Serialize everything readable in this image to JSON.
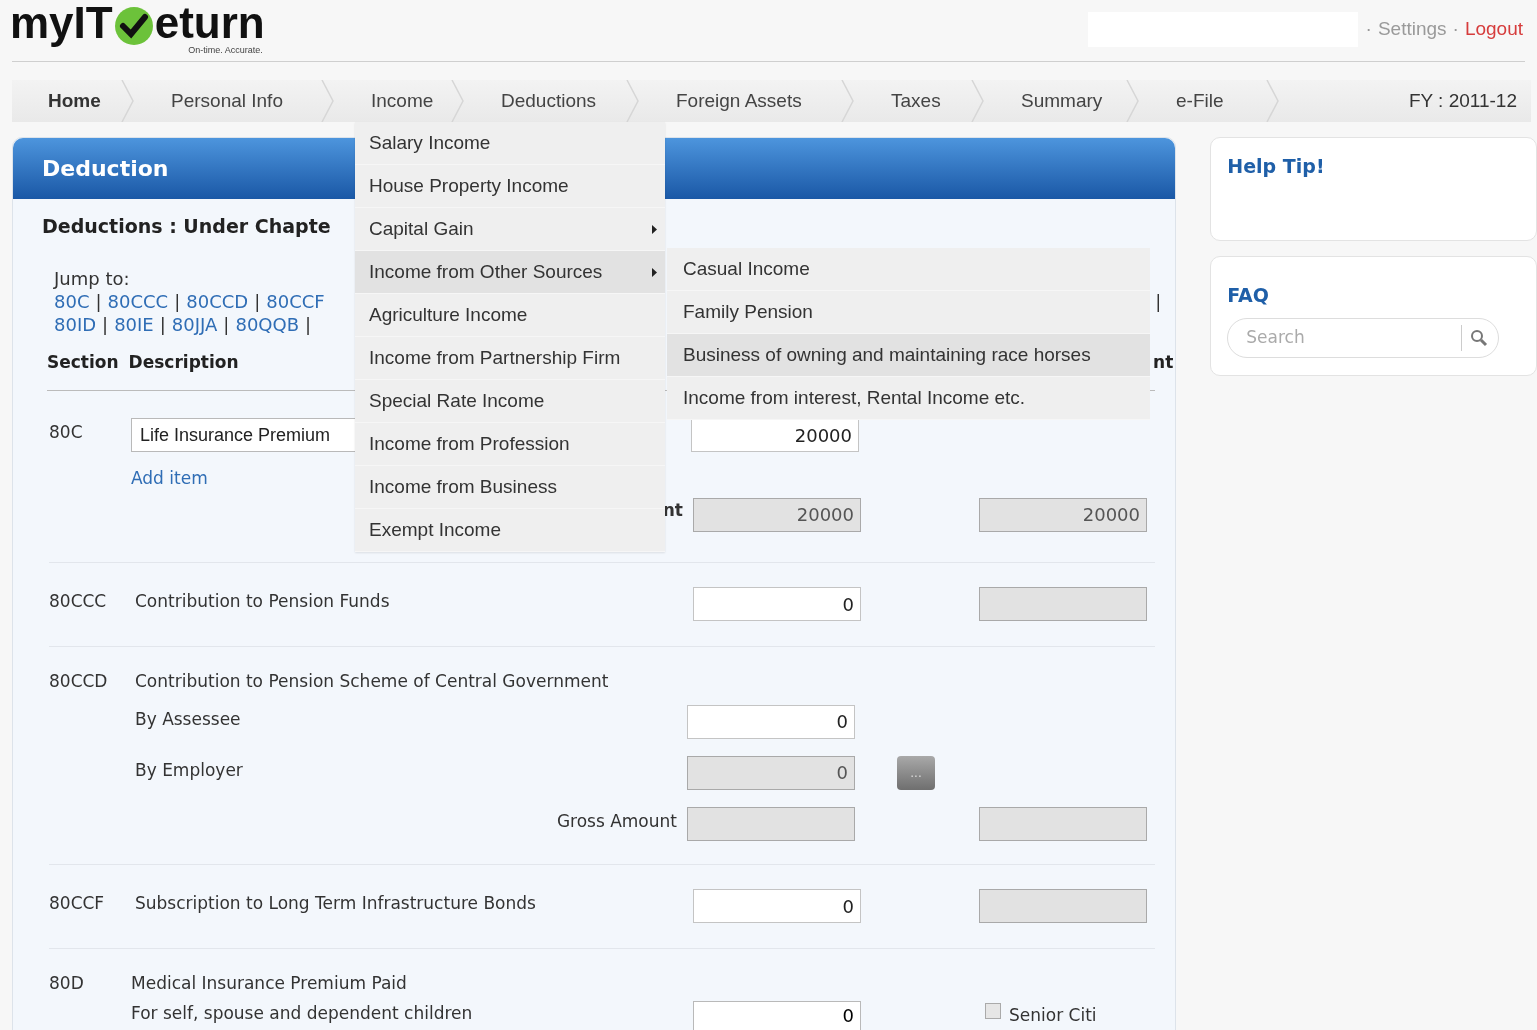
{
  "logo": {
    "name_start": "myIT",
    "name_end": "eturn",
    "tagline": "On-time. Accurate."
  },
  "header_separator": "·",
  "header_links": [
    {
      "label": "Settings",
      "kind": "normal"
    },
    {
      "label": "Logout",
      "kind": "logout"
    }
  ],
  "nav": {
    "tabs": [
      {
        "label": "Home",
        "selected": true
      },
      {
        "label": "Personal Info",
        "selected": false
      },
      {
        "label": "Income",
        "selected": false
      },
      {
        "label": "Deductions",
        "selected": false
      },
      {
        "label": "Foreign Assets",
        "selected": false
      },
      {
        "label": "Taxes",
        "selected": false
      },
      {
        "label": "Summary",
        "selected": false
      },
      {
        "label": "e-File",
        "selected": false
      }
    ],
    "fiscal_year": "FY : 2011-12"
  },
  "income_menu": {
    "items": [
      {
        "label": "Salary Income",
        "has_submenu": false,
        "selected": false
      },
      {
        "label": "House Property Income",
        "has_submenu": false,
        "selected": false
      },
      {
        "label": "Capital Gain",
        "has_submenu": true,
        "selected": false
      },
      {
        "label": "Income from Other Sources",
        "has_submenu": true,
        "selected": true
      },
      {
        "label": "Agriculture Income",
        "has_submenu": false,
        "selected": false
      },
      {
        "label": "Income from Partnership Firm",
        "has_submenu": false,
        "selected": false
      },
      {
        "label": "Special Rate Income",
        "has_submenu": false,
        "selected": false
      },
      {
        "label": "Income from Profession",
        "has_submenu": false,
        "selected": false
      },
      {
        "label": "Income from Business",
        "has_submenu": false,
        "selected": false
      },
      {
        "label": "Exempt Income",
        "has_submenu": false,
        "selected": false
      }
    ],
    "submenu": [
      {
        "label": "Casual Income",
        "selected": false
      },
      {
        "label": "Family Pension",
        "selected": false
      },
      {
        "label": "Business of owning and maintaining race horses",
        "selected": true
      },
      {
        "label": "Income from interest, Rental Income etc.",
        "selected": false
      }
    ]
  },
  "panel": {
    "title": "Deduction",
    "subtitle": "Deductions : Under Chapte",
    "jump_label": "Jump to:",
    "jump_separator": "|",
    "jump_rows": [
      {
        "links": [
          "80C",
          "80CCC",
          "80CCD",
          "80CCF"
        ],
        "trailing_separator": false
      },
      {
        "links": [
          "80ID",
          "80IE",
          "80JJA",
          "80QQB"
        ],
        "trailing_separator": true
      }
    ],
    "jump_overflow": "|",
    "columns": [
      "Section",
      "Description"
    ],
    "column_fragment": "nt",
    "rows": [
      {
        "kind": "select",
        "section": "80C",
        "value": "Life Insurance Premium",
        "amount": "20000",
        "link": "Add item",
        "total_fragment": "nt",
        "total_amount": "20000",
        "total_eligible": "20000"
      },
      {
        "kind": "simple",
        "section": "80CCC",
        "description": "Contribution to Pension Funds",
        "amount": "0"
      },
      {
        "kind": "split",
        "section": "80CCD",
        "description": "Contribution to Pension Scheme of Central Government",
        "parts": [
          {
            "label": "By Assessee",
            "amount": "0",
            "disabled": false
          },
          {
            "label": "By Employer",
            "amount": "0",
            "disabled": true,
            "button": "..."
          }
        ],
        "gross_label": "Gross Amount"
      },
      {
        "kind": "simple",
        "section": "80CCF",
        "description": "Subscription to Long Term Infrastructure Bonds",
        "amount": "0"
      },
      {
        "kind": "medical",
        "section": "80D",
        "description": "Medical Insurance Premium Paid",
        "sub_label": "For self, spouse and dependent children",
        "amount": "0",
        "checkbox_label": "Senior Citi",
        "checked": false
      }
    ]
  },
  "sidebar": {
    "help_title": "Help Tip!",
    "faq_title": "FAQ",
    "search_placeholder": "Search"
  }
}
